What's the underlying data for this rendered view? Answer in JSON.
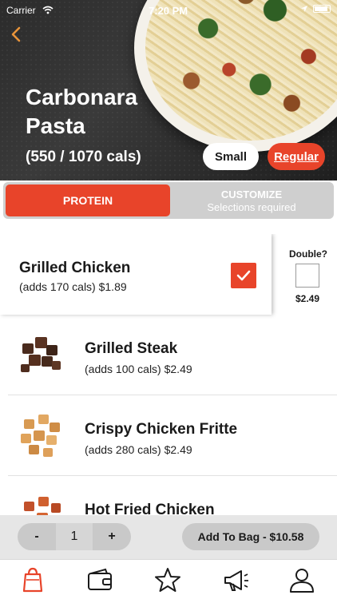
{
  "status_bar": {
    "carrier": "Carrier",
    "time": "7:20 PM"
  },
  "product": {
    "title": "Carbonara Pasta",
    "calories": "(550 / 1070 cals)"
  },
  "sizes": {
    "small": "Small",
    "regular": "Regular",
    "selected": "Regular"
  },
  "tabs": {
    "protein": "PROTEIN",
    "customize": "CUSTOMIZE",
    "customize_sub": "Selections required"
  },
  "proteins": [
    {
      "name": "Grilled Chicken",
      "detail": "(adds 170 cals)   $1.89",
      "selected": true,
      "double_label": "Double?",
      "double_price": "$2.49"
    },
    {
      "name": "Grilled Steak",
      "detail": "(adds 100 cals)   $2.49",
      "selected": false
    },
    {
      "name": "Crispy Chicken Fritte",
      "detail": "(adds 280 cals)   $2.49",
      "selected": false
    },
    {
      "name": "Hot Fried Chicken",
      "detail": "",
      "selected": false
    }
  ],
  "order": {
    "minus": "-",
    "quantity": "1",
    "plus": "+",
    "add_to_bag": "Add To Bag - $10.58"
  },
  "tabbar": [
    "bag-icon",
    "wallet-icon",
    "star-icon",
    "megaphone-icon",
    "profile-icon"
  ],
  "colors": {
    "accent": "#e8442a",
    "bar": "#e6e6e6"
  }
}
